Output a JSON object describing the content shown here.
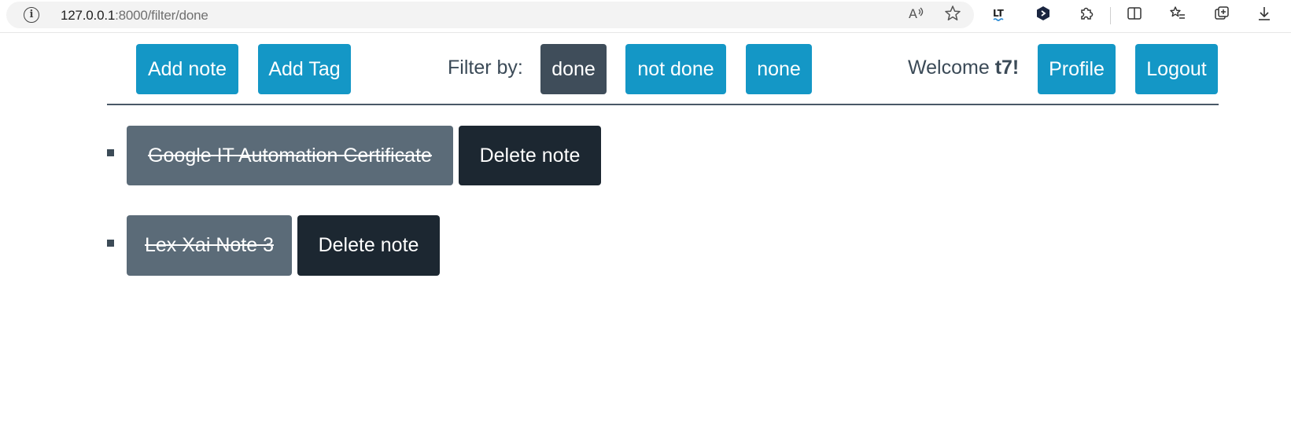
{
  "browser": {
    "url_host": "127.0.0.1",
    "url_path": ":8000/filter/done"
  },
  "navbar": {
    "add_note_label": "Add note",
    "add_tag_label": "Add Tag",
    "filter_label": "Filter by:",
    "filters": [
      {
        "label": "done",
        "active": true
      },
      {
        "label": "not done",
        "active": false
      },
      {
        "label": "none",
        "active": false
      }
    ],
    "welcome_text": "Welcome",
    "username": "t7!",
    "profile_label": "Profile",
    "logout_label": "Logout"
  },
  "notes": [
    {
      "title": "Google IT Automation Certificate",
      "done": true,
      "delete_label": "Delete note"
    },
    {
      "title": "Lex Xai Note 3",
      "done": true,
      "delete_label": "Delete note"
    }
  ],
  "colors": {
    "primary": "#1497c6",
    "active_filter": "#3f4d5a",
    "note_done": "#5b6b78",
    "delete": "#1c2731"
  }
}
